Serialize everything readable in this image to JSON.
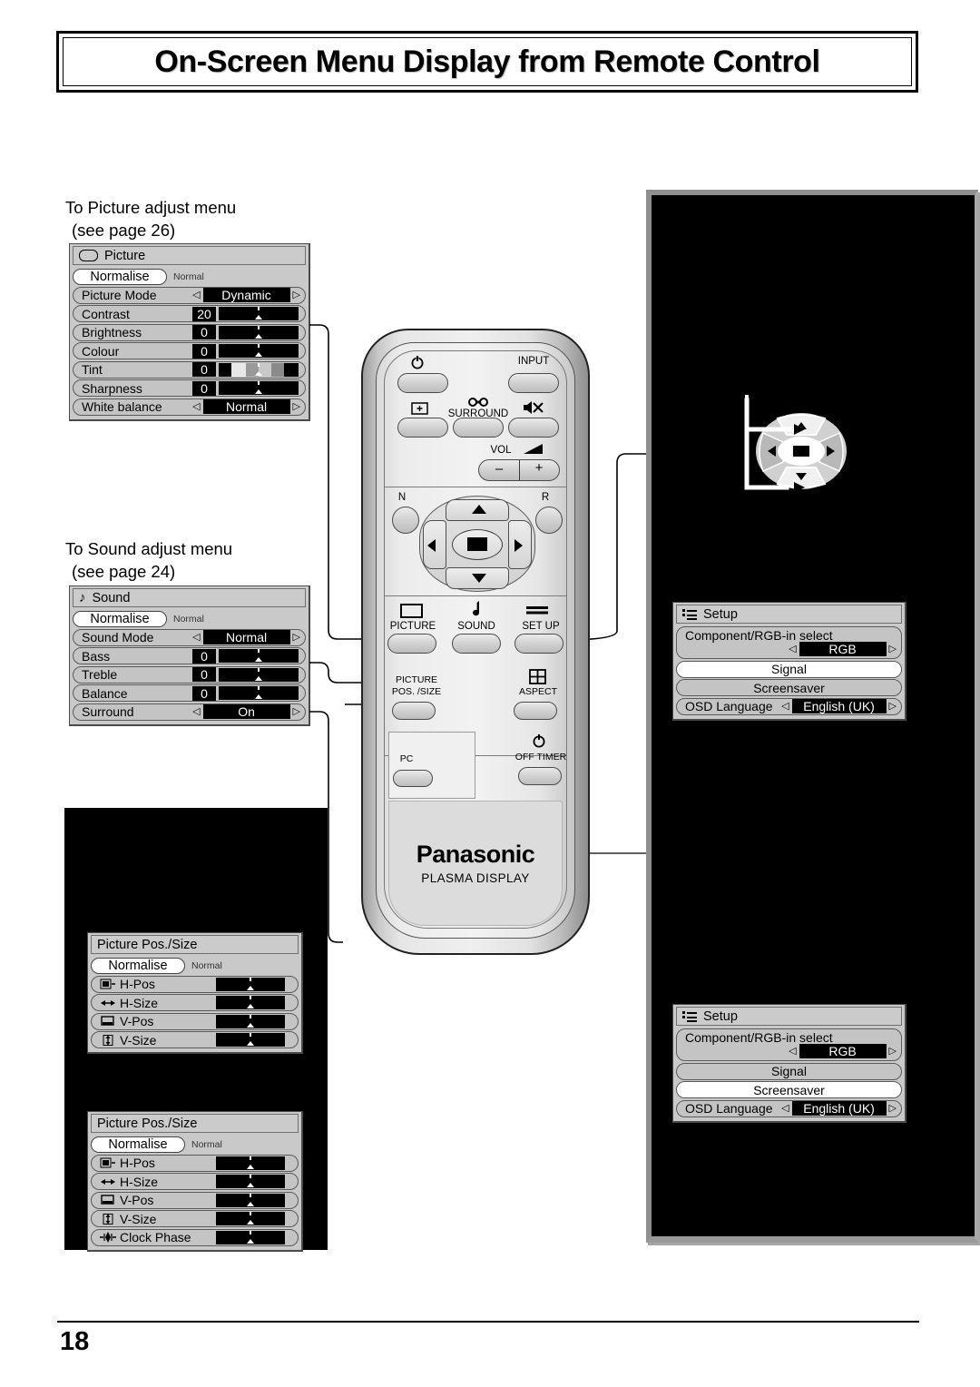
{
  "header": {
    "title": "On-Screen Menu Display from Remote Control"
  },
  "footer": {
    "page_number": "18"
  },
  "captions": {
    "picture": {
      "line1": "To Picture adjust menu",
      "line2": "(see page 26)"
    },
    "sound": {
      "line1": "To Sound adjust menu",
      "line2": "(see page 24)"
    }
  },
  "menus": {
    "picture": {
      "title": "Picture",
      "title_icon": "picture-screen-icon",
      "normalise": {
        "button": "Normalise",
        "state": "Normal"
      },
      "rows": [
        {
          "label": "Picture  Mode",
          "type": "select",
          "value": "Dynamic"
        },
        {
          "label": "Contrast",
          "type": "slider",
          "value": "20"
        },
        {
          "label": "Brightness",
          "type": "slider",
          "value": "0"
        },
        {
          "label": "Colour",
          "type": "slider",
          "value": "0"
        },
        {
          "label": "Tint",
          "type": "slider-tint",
          "value": "0"
        },
        {
          "label": "Sharpness",
          "type": "slider",
          "value": "0"
        },
        {
          "label": "White balance",
          "type": "select",
          "value": "Normal"
        }
      ]
    },
    "sound": {
      "title": "Sound",
      "title_icon": "music-note-icon",
      "normalise": {
        "button": "Normalise",
        "state": "Normal"
      },
      "rows": [
        {
          "label": "Sound Mode",
          "type": "select",
          "value": "Normal"
        },
        {
          "label": "Bass",
          "type": "slider",
          "value": "0"
        },
        {
          "label": "Treble",
          "type": "slider",
          "value": "0"
        },
        {
          "label": "Balance",
          "type": "slider",
          "value": "0"
        },
        {
          "label": "Surround",
          "type": "select",
          "value": "On"
        }
      ]
    },
    "pos_size_1": {
      "title": "Picture  Pos./Size",
      "normalise": {
        "button": "Normalise",
        "state": "Normal"
      },
      "rows": [
        {
          "label": "H-Pos",
          "icon": "h-pos-icon"
        },
        {
          "label": "H-Size",
          "icon": "h-size-icon"
        },
        {
          "label": "V-Pos",
          "icon": "v-pos-icon"
        },
        {
          "label": "V-Size",
          "icon": "v-size-icon"
        }
      ]
    },
    "pos_size_2": {
      "title": "Picture  Pos./Size",
      "normalise": {
        "button": "Normalise",
        "state": "Normal"
      },
      "rows": [
        {
          "label": "H-Pos",
          "icon": "h-pos-icon"
        },
        {
          "label": "H-Size",
          "icon": "h-size-icon"
        },
        {
          "label": "V-Pos",
          "icon": "v-pos-icon"
        },
        {
          "label": "V-Size",
          "icon": "v-size-icon"
        },
        {
          "label": "Clock  Phase",
          "icon": "clock-phase-icon"
        }
      ]
    },
    "setup_1": {
      "title": "Setup",
      "title_icon": "setup-list-icon",
      "rows": [
        {
          "label": "Component/RGB-in select",
          "type": "select",
          "value": "RGB",
          "highlight": false
        },
        {
          "label": "Signal",
          "type": "plain",
          "highlight": true
        },
        {
          "label": "Screensaver",
          "type": "plain",
          "highlight": false
        },
        {
          "label": "OSD  Language",
          "type": "select",
          "value": "English (UK)",
          "highlight": false
        }
      ]
    },
    "setup_2": {
      "title": "Setup",
      "title_icon": "setup-list-icon",
      "rows": [
        {
          "label": "Component/RGB-in select",
          "type": "select",
          "value": "RGB",
          "highlight": false
        },
        {
          "label": "Signal",
          "type": "plain",
          "highlight": false
        },
        {
          "label": "Screensaver",
          "type": "plain",
          "highlight": true
        },
        {
          "label": "OSD  Language",
          "type": "select",
          "value": "English (UK)",
          "highlight": false
        }
      ]
    }
  },
  "remote": {
    "brand": "Panasonic",
    "subbrand": "PLASMA DISPLAY",
    "labels": {
      "power": "",
      "input": "INPUT",
      "surround": "SURROUND",
      "mute": "",
      "vol": "VOL",
      "n": "N",
      "r": "R",
      "picture": "PICTURE",
      "sound": "SOUND",
      "setup": "SET UP",
      "picture_pos_size_l1": "PICTURE",
      "picture_pos_size_l2": "POS. /SIZE",
      "aspect": "ASPECT",
      "pc": "PC",
      "off_timer": "OFF TIMER",
      "vol_minus": "–",
      "vol_plus": "+"
    }
  },
  "colors": {
    "screen_black": "#000000",
    "osd_grey": "#c9c9c9",
    "osd_value_black": "#000000",
    "panel_bezel": "#8f8f8f"
  }
}
